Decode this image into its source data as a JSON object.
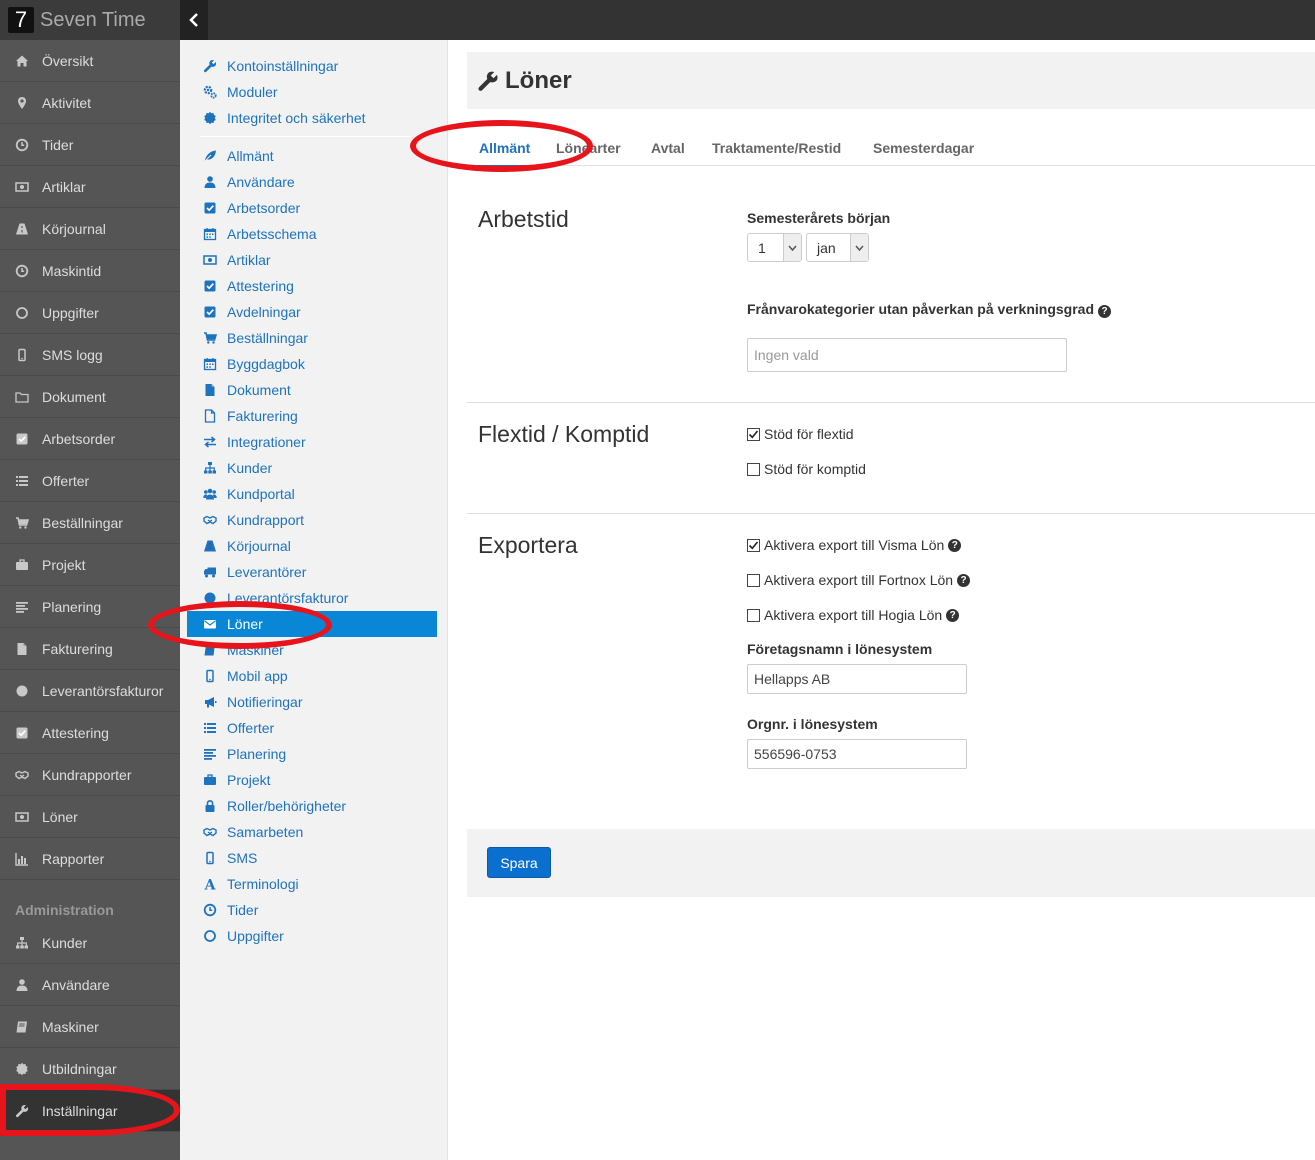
{
  "app": {
    "logo": "7",
    "name": "Seven Time"
  },
  "colors": {
    "accent": "#1e73be",
    "active_bg": "#0a86d6",
    "annotation": "#e8141c"
  },
  "leftnav": {
    "items": [
      {
        "label": "Översikt",
        "icon": "home-icon"
      },
      {
        "label": "Aktivitet",
        "icon": "map-marker-icon"
      },
      {
        "label": "Tider",
        "icon": "clock-icon"
      },
      {
        "label": "Artiklar",
        "icon": "money-icon"
      },
      {
        "label": "Körjournal",
        "icon": "road-icon"
      },
      {
        "label": "Maskintid",
        "icon": "clock-icon"
      },
      {
        "label": "Uppgifter",
        "icon": "circle-icon"
      },
      {
        "label": "SMS logg",
        "icon": "mobile-icon"
      },
      {
        "label": "Dokument",
        "icon": "folder-icon"
      },
      {
        "label": "Arbetsorder",
        "icon": "check-square-icon"
      },
      {
        "label": "Offerter",
        "icon": "list-icon"
      },
      {
        "label": "Beställningar",
        "icon": "cart-icon"
      },
      {
        "label": "Projekt",
        "icon": "briefcase-icon"
      },
      {
        "label": "Planering",
        "icon": "align-left-icon"
      },
      {
        "label": "Fakturering",
        "icon": "file-icon"
      },
      {
        "label": "Leverantörsfakturor",
        "icon": "circle-filled-icon"
      },
      {
        "label": "Attestering",
        "icon": "check-square-icon"
      },
      {
        "label": "Kundrapporter",
        "icon": "handshake-icon"
      },
      {
        "label": "Löner",
        "icon": "money-icon"
      },
      {
        "label": "Rapporter",
        "icon": "bar-chart-icon"
      }
    ],
    "admin_header": "Administration",
    "admin_items": [
      {
        "label": "Kunder",
        "icon": "sitemap-icon"
      },
      {
        "label": "Användare",
        "icon": "user-icon"
      },
      {
        "label": "Maskiner",
        "icon": "book-icon"
      },
      {
        "label": "Utbildningar",
        "icon": "certificate-icon"
      },
      {
        "label": "Inställningar",
        "icon": "wrench-icon"
      }
    ]
  },
  "subnav": {
    "top_items": [
      {
        "label": "Kontoinställningar",
        "icon": "wrench-icon"
      },
      {
        "label": "Moduler",
        "icon": "cogs-icon"
      },
      {
        "label": "Integritet och säkerhet",
        "icon": "certificate-icon"
      }
    ],
    "items": [
      {
        "label": "Allmänt",
        "icon": "leaf-icon"
      },
      {
        "label": "Användare",
        "icon": "user-icon"
      },
      {
        "label": "Arbetsorder",
        "icon": "check-square-icon"
      },
      {
        "label": "Arbetsschema",
        "icon": "calendar-icon"
      },
      {
        "label": "Artiklar",
        "icon": "money-icon"
      },
      {
        "label": "Attestering",
        "icon": "check-square-icon"
      },
      {
        "label": "Avdelningar",
        "icon": "check-square-icon"
      },
      {
        "label": "Beställningar",
        "icon": "cart-icon"
      },
      {
        "label": "Byggdagbok",
        "icon": "calendar-icon"
      },
      {
        "label": "Dokument",
        "icon": "file-icon"
      },
      {
        "label": "Fakturering",
        "icon": "file-outline-icon"
      },
      {
        "label": "Integrationer",
        "icon": "exchange-icon"
      },
      {
        "label": "Kunder",
        "icon": "sitemap-icon"
      },
      {
        "label": "Kundportal",
        "icon": "users-icon"
      },
      {
        "label": "Kundrapport",
        "icon": "handshake-icon"
      },
      {
        "label": "Körjournal",
        "icon": "road-icon"
      },
      {
        "label": "Leverantörer",
        "icon": "truck-icon"
      },
      {
        "label": "Leverantörsfakturor",
        "icon": "circle-filled-icon"
      },
      {
        "label": "Löner",
        "icon": "envelope-icon"
      },
      {
        "label": "Maskiner",
        "icon": "book-icon"
      },
      {
        "label": "Mobil app",
        "icon": "mobile-icon"
      },
      {
        "label": "Notifieringar",
        "icon": "bullhorn-icon"
      },
      {
        "label": "Offerter",
        "icon": "list-icon"
      },
      {
        "label": "Planering",
        "icon": "align-left-icon"
      },
      {
        "label": "Projekt",
        "icon": "briefcase-icon"
      },
      {
        "label": "Roller/behörigheter",
        "icon": "lock-icon"
      },
      {
        "label": "Samarbeten",
        "icon": "handshake-icon"
      },
      {
        "label": "SMS",
        "icon": "mobile-icon"
      },
      {
        "label": "Terminologi",
        "icon": "font-icon"
      },
      {
        "label": "Tider",
        "icon": "clock-icon"
      },
      {
        "label": "Uppgifter",
        "icon": "circle-icon"
      }
    ],
    "active_label": "Löner"
  },
  "main": {
    "title": "Löner",
    "title_icon": "wrench-icon",
    "tabs": [
      {
        "label": "Allmänt",
        "active": true
      },
      {
        "label": "Lönearter",
        "active": false
      },
      {
        "label": "Avtal",
        "active": false
      },
      {
        "label": "Traktamente/Restid",
        "active": false
      },
      {
        "label": "Semesterdagar",
        "active": false
      }
    ],
    "arbetstid": {
      "title": "Arbetstid",
      "semester_label": "Semesterårets början",
      "day_value": "1",
      "month_value": "jan",
      "franvaro_label": "Frånvarokategorier utan påverkan på verkningsgrad",
      "franvaro_placeholder": "Ingen vald"
    },
    "flextid": {
      "title": "Flextid / Komptid",
      "flex_label": "Stöd för flextid",
      "flex_checked": true,
      "komp_label": "Stöd för komptid",
      "komp_checked": false
    },
    "exportera": {
      "title": "Exportera",
      "visma_label": "Aktivera export till Visma Lön",
      "visma_checked": true,
      "fortnox_label": "Aktivera export till Fortnox Lön",
      "fortnox_checked": false,
      "hogia_label": "Aktivera export till Hogia Lön",
      "hogia_checked": false,
      "company_label": "Företagsnamn i lönesystem",
      "company_value": "Hellapps AB",
      "orgnr_label": "Orgnr. i lönesystem",
      "orgnr_value": "556596-0753"
    },
    "save_label": "Spara"
  }
}
